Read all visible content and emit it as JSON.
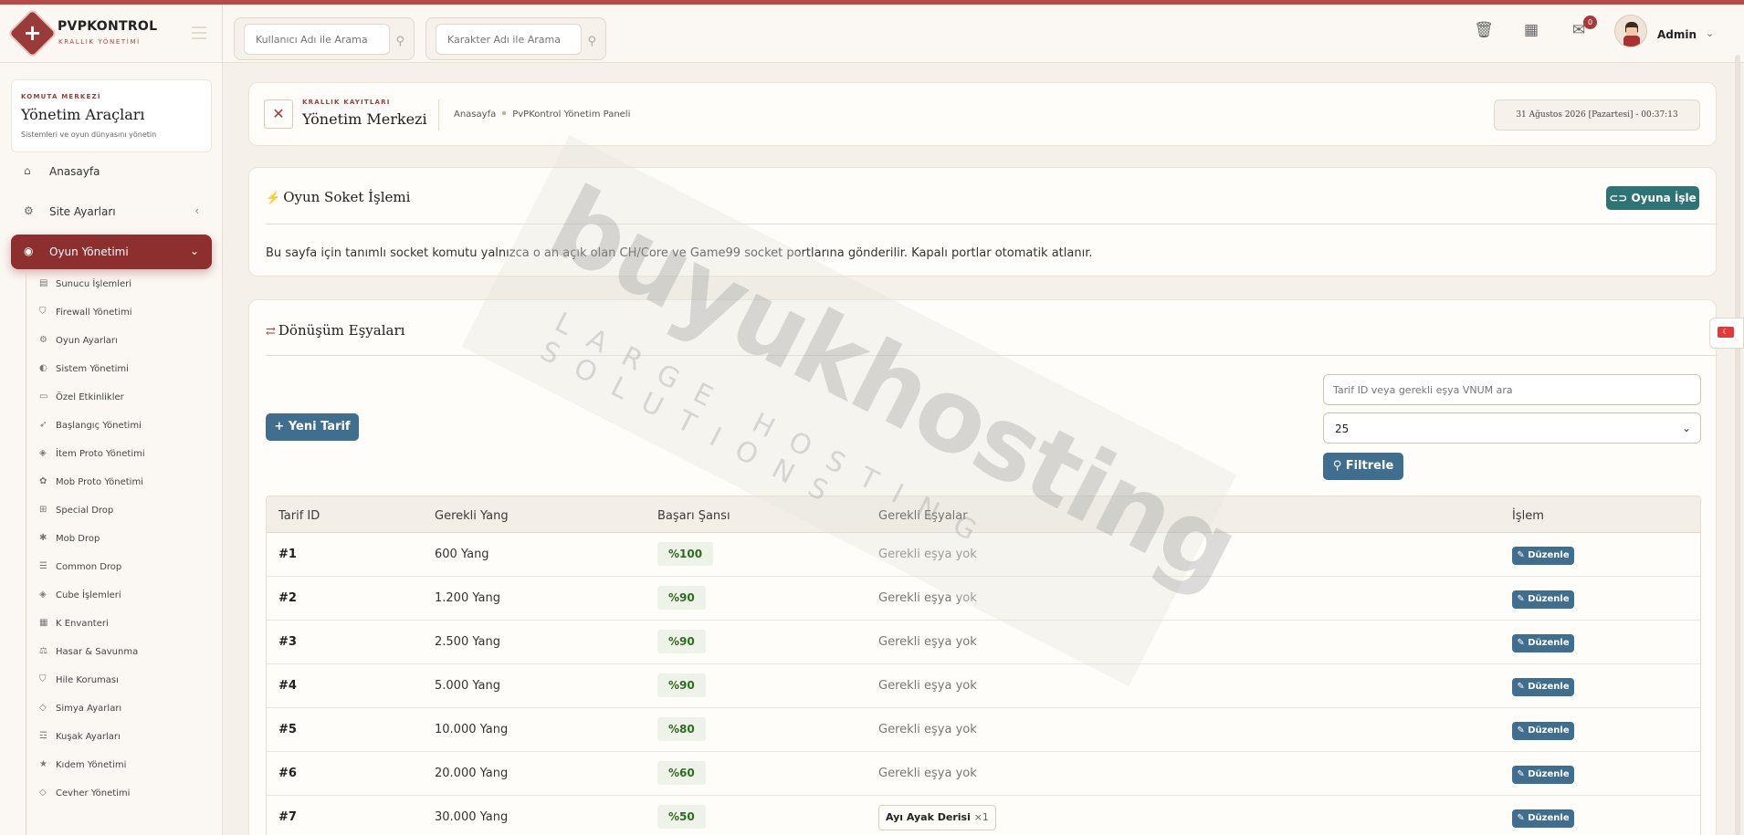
{
  "brand": {
    "title": "PVPKONTROL",
    "subtitle": "KRALLIK YÖNETİMİ"
  },
  "header": {
    "search_user_placeholder": "Kullanıcı Adı ile Arama",
    "search_char_placeholder": "Karakter Adı ile Arama",
    "message_count": "0",
    "admin_name": "Admin"
  },
  "sidebar": {
    "kicker": "KOMUTA MERKEZİ",
    "title": "Yönetim Araçları",
    "subtitle": "Sistemleri ve oyun dünyasını yönetin",
    "nav": [
      {
        "label": "Anasayfa"
      },
      {
        "label": "Site Ayarları"
      },
      {
        "label": "Oyun Yönetimi"
      }
    ],
    "sub_items": [
      {
        "label": "Sunucu İşlemleri"
      },
      {
        "label": "Firewall Yönetimi"
      },
      {
        "label": "Oyun Ayarları"
      },
      {
        "label": "Sistem Yönetimi"
      },
      {
        "label": "Özel Etkinlikler"
      },
      {
        "label": "Başlangıç Yönetimi"
      },
      {
        "label": "İtem Proto Yönetimi"
      },
      {
        "label": "Mob Proto Yönetimi"
      },
      {
        "label": "Special Drop"
      },
      {
        "label": "Mob Drop"
      },
      {
        "label": "Common Drop"
      },
      {
        "label": "Cube İşlemleri"
      },
      {
        "label": "K Envanteri"
      },
      {
        "label": "Hasar & Savunma"
      },
      {
        "label": "Hile Koruması"
      },
      {
        "label": "Simya Ayarları"
      },
      {
        "label": "Kuşak Ayarları"
      },
      {
        "label": "Kıdem Yönetimi"
      },
      {
        "label": "Cevher Yönetimi"
      }
    ]
  },
  "breadcrumb": {
    "kicker": "KRALLIK KAYITLARI",
    "title": "Yönetim Merkezi",
    "home": "Anasayfa",
    "current": "PvPKontrol Yönetim Paneli",
    "clock": "31 Ağustos 2026 [Pazartesi] - 00:37:13"
  },
  "socket": {
    "title": "Oyun Soket İşlemi",
    "button": "Oyuna İşle",
    "info": "Bu sayfa için tanımlı socket komutu yalnızca o an açık olan CH/Core ve Game99 socket portlarına gönderilir. Kapalı portlar otomatik atlanır."
  },
  "recipes": {
    "title": "Dönüşüm Eşyaları",
    "new_button": "Yeni Tarif",
    "search_placeholder": "Tarif ID veya gerekli eşya VNUM ara",
    "page_size": "25",
    "filter_button": "Filtrele",
    "columns": [
      "Tarif ID",
      "Gerekli Yang",
      "Başarı Şansı",
      "Gerekli Eşyalar",
      "İşlem"
    ],
    "edit_label": "Düzenle",
    "rows": [
      {
        "id": "#1",
        "yang": "600 Yang",
        "chance": "%100",
        "items": "Gerekli eşya yok"
      },
      {
        "id": "#2",
        "yang": "1.200 Yang",
        "chance": "%90",
        "items": "Gerekli eşya yok"
      },
      {
        "id": "#3",
        "yang": "2.500 Yang",
        "chance": "%90",
        "items": "Gerekli eşya yok"
      },
      {
        "id": "#4",
        "yang": "5.000 Yang",
        "chance": "%90",
        "items": "Gerekli eşya yok"
      },
      {
        "id": "#5",
        "yang": "10.000 Yang",
        "chance": "%80",
        "items": "Gerekli eşya yok"
      },
      {
        "id": "#6",
        "yang": "20.000 Yang",
        "chance": "%60",
        "items": "Gerekli eşya yok"
      },
      {
        "id": "#7",
        "yang": "30.000 Yang",
        "chance": "%50",
        "item_name": "Ayı Ayak Derisi",
        "item_qty": "×1"
      }
    ]
  },
  "watermark": {
    "brand": "buyukhosting",
    "tagline": "LARGE HOSTING SOLUTIONS"
  },
  "colors": {
    "accent": "#8e2f2f",
    "teal": "#2e7474",
    "blue": "#3f6e8e",
    "success": "#2f6a1f"
  }
}
